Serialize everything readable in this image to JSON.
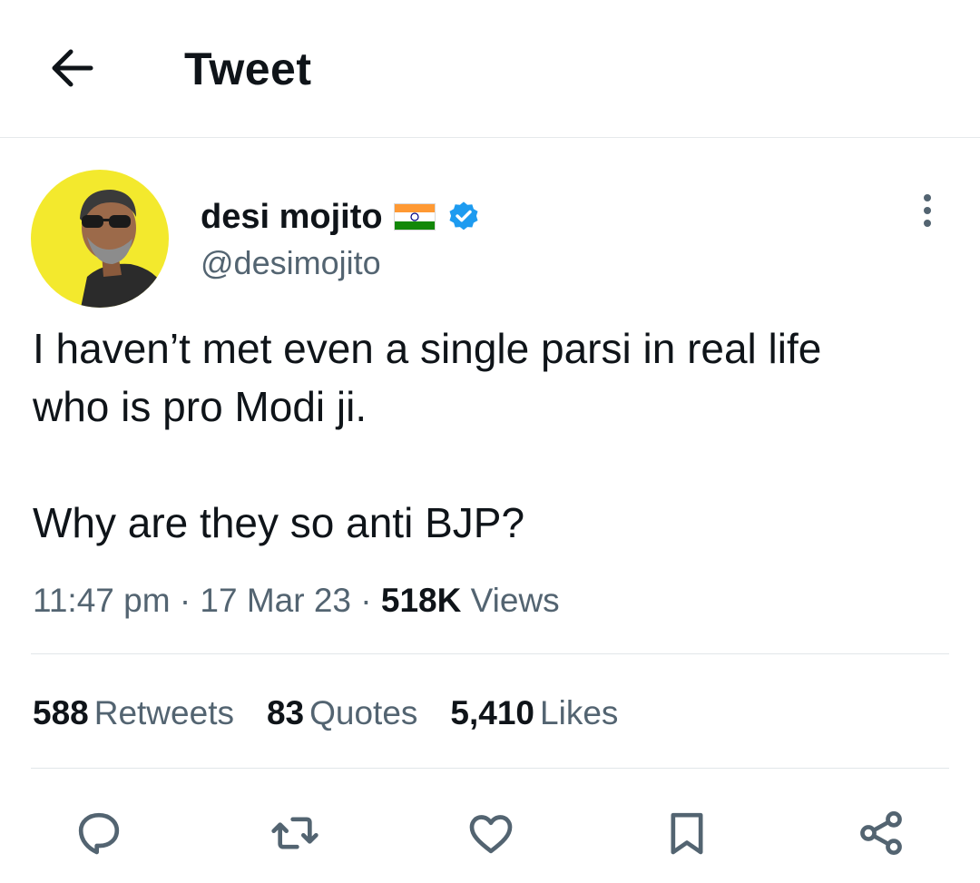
{
  "header": {
    "title": "Tweet",
    "back_icon": "arrow-left-icon"
  },
  "author": {
    "display_name": "desi mojito",
    "flag_icon": "india-flag-icon",
    "verified_icon": "verified-badge-icon",
    "handle": "@desimojito",
    "avatar_bg_color": "#f3e92d"
  },
  "tweet": {
    "paragraphs": [
      [
        "I haven’t met even a single parsi in real life",
        "who is pro Modi ji."
      ],
      [
        "Why are they so anti BJP?"
      ]
    ]
  },
  "meta": {
    "time": "11:47 pm",
    "date": "17 Mar 23",
    "views_count": "518K",
    "views_label": "Views"
  },
  "stats": {
    "retweets_count": "588",
    "retweets_label": "Retweets",
    "quotes_count": "83",
    "quotes_label": "Quotes",
    "likes_count": "5,410",
    "likes_label": "Likes"
  },
  "actions": [
    "reply-icon",
    "retweet-icon",
    "like-icon",
    "bookmark-icon",
    "share-icon"
  ],
  "colors": {
    "text_primary": "#0f1419",
    "text_secondary": "#536471",
    "verified_blue": "#1d9bf0",
    "divider": "#e1e6e9"
  }
}
